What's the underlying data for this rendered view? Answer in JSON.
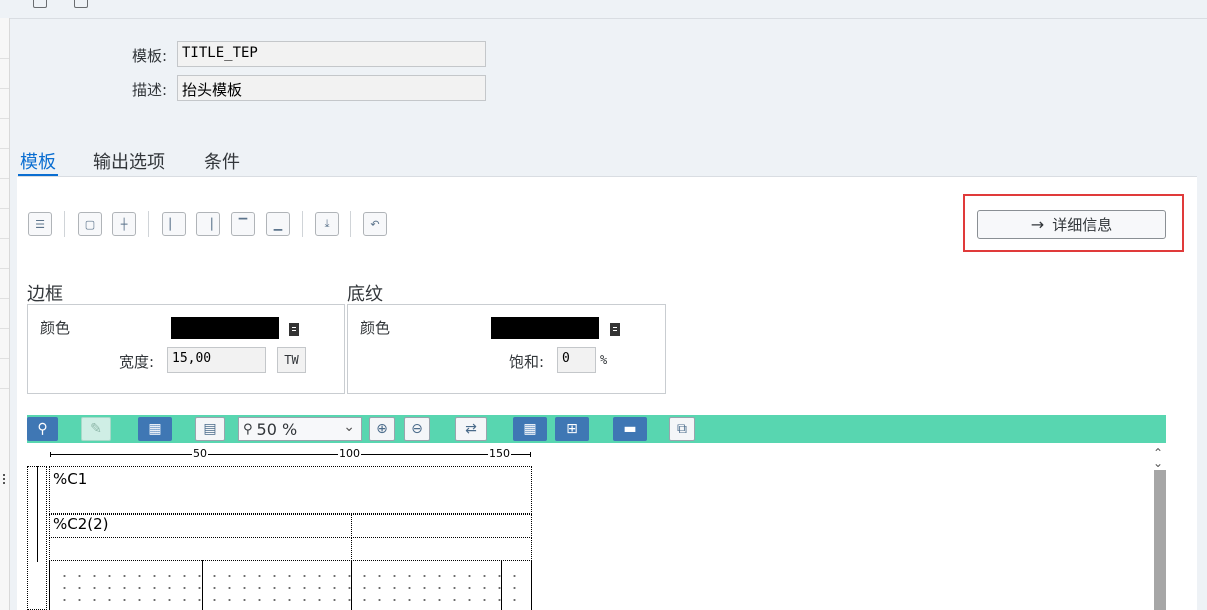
{
  "form": {
    "template_label": "模板:",
    "template_value": "TITLE_TEP",
    "desc_label": "描述:",
    "desc_value": "抬头模板"
  },
  "tabs": [
    {
      "label": "模板",
      "active": true
    },
    {
      "label": "输出选项",
      "active": false
    },
    {
      "label": "条件",
      "active": false
    }
  ],
  "detail_button": {
    "label": "详细信息",
    "icon": "arrow-right-icon"
  },
  "border_group": {
    "title": "边框",
    "color_label": "颜色",
    "width_label": "宽度:",
    "width_value": "15,00",
    "width_unit": "TW"
  },
  "shading_group": {
    "title": "底纹",
    "color_label": "颜色",
    "sat_label": "饱和:",
    "sat_value": "0",
    "sat_unit": "%"
  },
  "zoom": {
    "value": "50 %"
  },
  "ruler": {
    "marks": [
      "50",
      "100",
      "150"
    ]
  },
  "canvas": {
    "cell1": "%C1",
    "cell2": "%C2(2)"
  },
  "colors": {
    "accent": "#0a6ed1",
    "toolbar_green": "#58d6b0",
    "highlight": "#e03a3a",
    "button_blue": "#3f77b4"
  }
}
